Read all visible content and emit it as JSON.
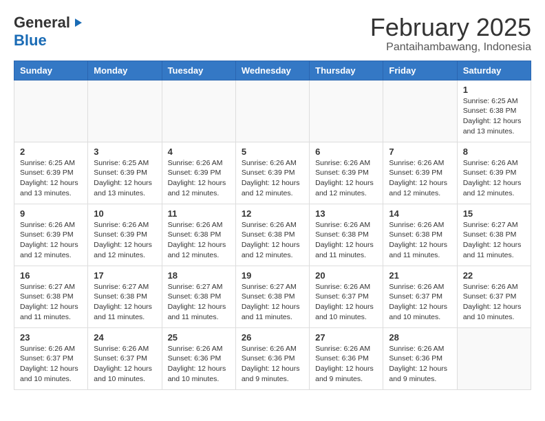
{
  "logo": {
    "general": "General",
    "blue": "Blue"
  },
  "title": "February 2025",
  "location": "Pantaihambawang, Indonesia",
  "days_of_week": [
    "Sunday",
    "Monday",
    "Tuesday",
    "Wednesday",
    "Thursday",
    "Friday",
    "Saturday"
  ],
  "weeks": [
    [
      {
        "day": "",
        "info": ""
      },
      {
        "day": "",
        "info": ""
      },
      {
        "day": "",
        "info": ""
      },
      {
        "day": "",
        "info": ""
      },
      {
        "day": "",
        "info": ""
      },
      {
        "day": "",
        "info": ""
      },
      {
        "day": "1",
        "info": "Sunrise: 6:25 AM\nSunset: 6:38 PM\nDaylight: 12 hours\nand 13 minutes."
      }
    ],
    [
      {
        "day": "2",
        "info": "Sunrise: 6:25 AM\nSunset: 6:39 PM\nDaylight: 12 hours\nand 13 minutes."
      },
      {
        "day": "3",
        "info": "Sunrise: 6:25 AM\nSunset: 6:39 PM\nDaylight: 12 hours\nand 13 minutes."
      },
      {
        "day": "4",
        "info": "Sunrise: 6:26 AM\nSunset: 6:39 PM\nDaylight: 12 hours\nand 12 minutes."
      },
      {
        "day": "5",
        "info": "Sunrise: 6:26 AM\nSunset: 6:39 PM\nDaylight: 12 hours\nand 12 minutes."
      },
      {
        "day": "6",
        "info": "Sunrise: 6:26 AM\nSunset: 6:39 PM\nDaylight: 12 hours\nand 12 minutes."
      },
      {
        "day": "7",
        "info": "Sunrise: 6:26 AM\nSunset: 6:39 PM\nDaylight: 12 hours\nand 12 minutes."
      },
      {
        "day": "8",
        "info": "Sunrise: 6:26 AM\nSunset: 6:39 PM\nDaylight: 12 hours\nand 12 minutes."
      }
    ],
    [
      {
        "day": "9",
        "info": "Sunrise: 6:26 AM\nSunset: 6:39 PM\nDaylight: 12 hours\nand 12 minutes."
      },
      {
        "day": "10",
        "info": "Sunrise: 6:26 AM\nSunset: 6:39 PM\nDaylight: 12 hours\nand 12 minutes."
      },
      {
        "day": "11",
        "info": "Sunrise: 6:26 AM\nSunset: 6:38 PM\nDaylight: 12 hours\nand 12 minutes."
      },
      {
        "day": "12",
        "info": "Sunrise: 6:26 AM\nSunset: 6:38 PM\nDaylight: 12 hours\nand 12 minutes."
      },
      {
        "day": "13",
        "info": "Sunrise: 6:26 AM\nSunset: 6:38 PM\nDaylight: 12 hours\nand 11 minutes."
      },
      {
        "day": "14",
        "info": "Sunrise: 6:26 AM\nSunset: 6:38 PM\nDaylight: 12 hours\nand 11 minutes."
      },
      {
        "day": "15",
        "info": "Sunrise: 6:27 AM\nSunset: 6:38 PM\nDaylight: 12 hours\nand 11 minutes."
      }
    ],
    [
      {
        "day": "16",
        "info": "Sunrise: 6:27 AM\nSunset: 6:38 PM\nDaylight: 12 hours\nand 11 minutes."
      },
      {
        "day": "17",
        "info": "Sunrise: 6:27 AM\nSunset: 6:38 PM\nDaylight: 12 hours\nand 11 minutes."
      },
      {
        "day": "18",
        "info": "Sunrise: 6:27 AM\nSunset: 6:38 PM\nDaylight: 12 hours\nand 11 minutes."
      },
      {
        "day": "19",
        "info": "Sunrise: 6:27 AM\nSunset: 6:38 PM\nDaylight: 12 hours\nand 11 minutes."
      },
      {
        "day": "20",
        "info": "Sunrise: 6:26 AM\nSunset: 6:37 PM\nDaylight: 12 hours\nand 10 minutes."
      },
      {
        "day": "21",
        "info": "Sunrise: 6:26 AM\nSunset: 6:37 PM\nDaylight: 12 hours\nand 10 minutes."
      },
      {
        "day": "22",
        "info": "Sunrise: 6:26 AM\nSunset: 6:37 PM\nDaylight: 12 hours\nand 10 minutes."
      }
    ],
    [
      {
        "day": "23",
        "info": "Sunrise: 6:26 AM\nSunset: 6:37 PM\nDaylight: 12 hours\nand 10 minutes."
      },
      {
        "day": "24",
        "info": "Sunrise: 6:26 AM\nSunset: 6:37 PM\nDaylight: 12 hours\nand 10 minutes."
      },
      {
        "day": "25",
        "info": "Sunrise: 6:26 AM\nSunset: 6:36 PM\nDaylight: 12 hours\nand 10 minutes."
      },
      {
        "day": "26",
        "info": "Sunrise: 6:26 AM\nSunset: 6:36 PM\nDaylight: 12 hours\nand 9 minutes."
      },
      {
        "day": "27",
        "info": "Sunrise: 6:26 AM\nSunset: 6:36 PM\nDaylight: 12 hours\nand 9 minutes."
      },
      {
        "day": "28",
        "info": "Sunrise: 6:26 AM\nSunset: 6:36 PM\nDaylight: 12 hours\nand 9 minutes."
      },
      {
        "day": "",
        "info": ""
      }
    ]
  ]
}
